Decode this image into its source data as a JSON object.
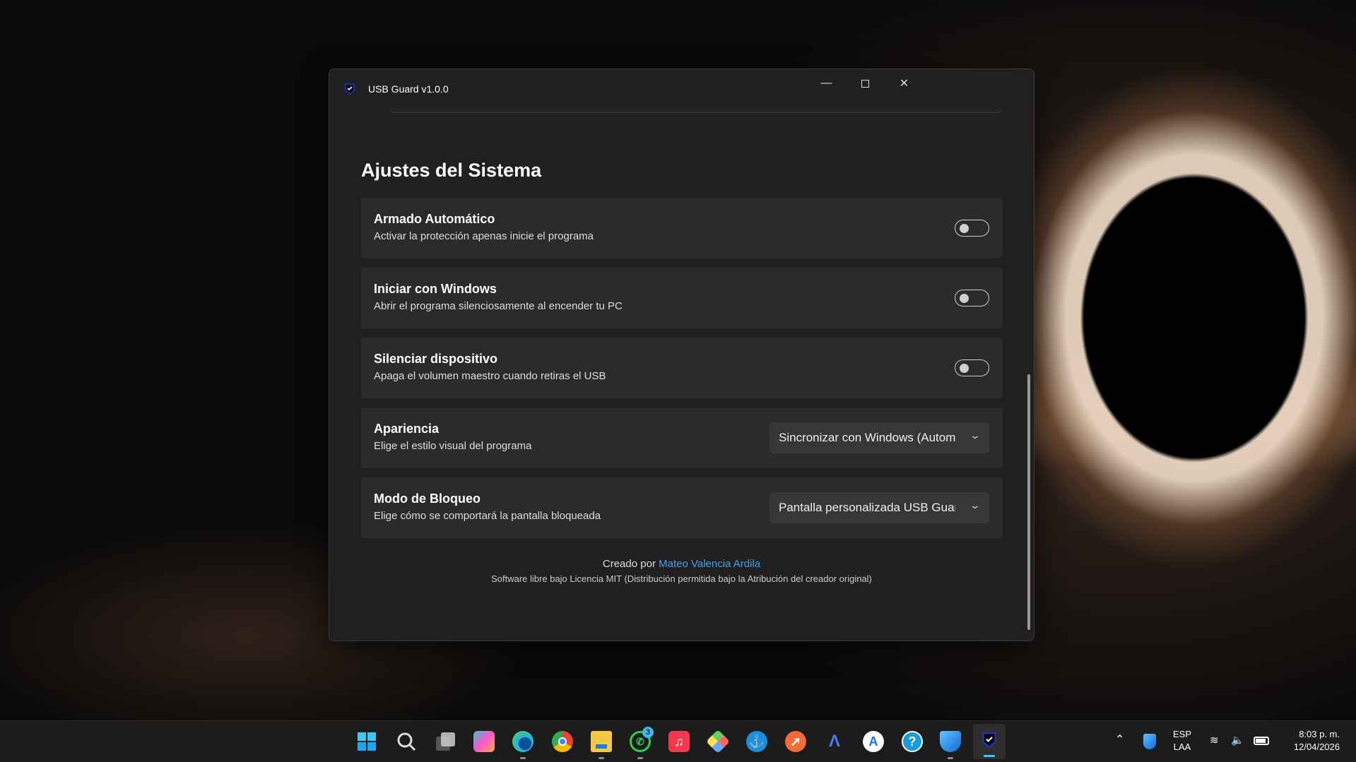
{
  "window": {
    "title": "USB Guard v1.0.0"
  },
  "page": {
    "heading": "Ajustes del Sistema"
  },
  "settings": [
    {
      "title": "Armado Automático",
      "subtitle": "Activar la protección apenas inicie el programa",
      "type": "toggle",
      "on": false
    },
    {
      "title": "Iniciar con Windows",
      "subtitle": "Abrir el programa silenciosamente al encender tu PC",
      "type": "toggle",
      "on": false
    },
    {
      "title": "Silenciar dispositivo",
      "subtitle": "Apaga el volumen maestro cuando retiras el USB",
      "type": "toggle",
      "on": false
    },
    {
      "title": "Apariencia",
      "subtitle": "Elige el estilo visual del programa",
      "type": "dropdown",
      "value": "Sincronizar con Windows (Automático)"
    },
    {
      "title": "Modo de Bloqueo",
      "subtitle": "Elige cómo se comportará la pantalla bloqueada",
      "type": "dropdown",
      "value": "Pantalla personalizada USB Guard"
    }
  ],
  "footer": {
    "created_by": "Creado por",
    "author": "Mateo Valencia Ardila",
    "license": "Software libre bajo Licencia MIT (Distribución permitida bajo la Atribución del creador original)"
  },
  "taskbar": {
    "whatsapp_badge": "3",
    "language": "ESP",
    "layout": "LAA",
    "time": "8:03 p. m.",
    "date": "12/04/2026"
  },
  "colors": {
    "accent": "#4a9ee8",
    "card": "#2b2b2b",
    "window": "#202020"
  }
}
